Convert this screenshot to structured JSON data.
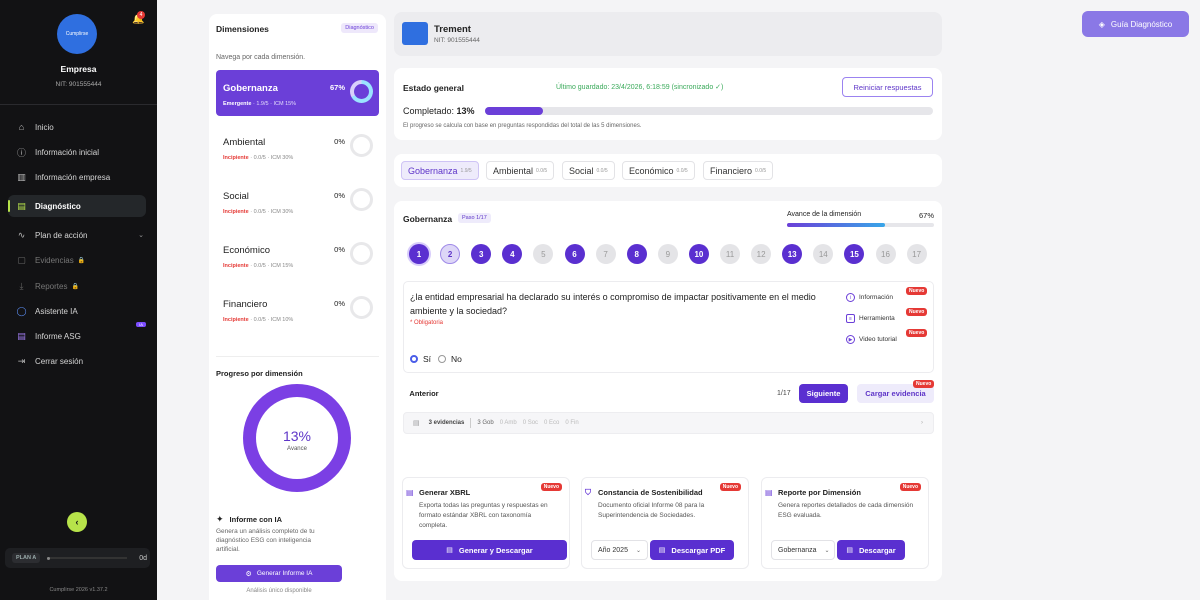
{
  "sidebar": {
    "company": "Empresa",
    "nit": "NIT: 901555444",
    "logo_text": "Cumplirse",
    "notifications": "4",
    "items": [
      {
        "label": "Inicio",
        "icon": "home-icon"
      },
      {
        "label": "Información inicial",
        "icon": "info-icon"
      },
      {
        "label": "Información empresa",
        "icon": "building-icon"
      },
      {
        "label": "Diagnóstico",
        "icon": "document-icon",
        "active": true
      },
      {
        "label": "Plan de acción",
        "icon": "activity-icon"
      },
      {
        "label": "Evidencias",
        "icon": "file-icon",
        "locked": true
      },
      {
        "label": "Reportes",
        "icon": "download-icon",
        "locked": true
      },
      {
        "label": "Asistente IA",
        "icon": "circle-icon"
      },
      {
        "label": "Informe ASG",
        "icon": "report-icon",
        "badge": "IA"
      },
      {
        "label": "Cerrar sesión",
        "icon": "logout-icon"
      }
    ],
    "plan_label": "PLAN A",
    "plan_days": "0d",
    "version": "Cumplirse 2026 v1.37.2"
  },
  "dimensions": {
    "title": "Dimensiones",
    "tag": "Diagnóstico",
    "subtitle": "Navega por cada dimensión.",
    "items": [
      {
        "name": "Gobernanza",
        "pct": "67%",
        "level": "Emergente",
        "score": "1.9/5",
        "icm": "ICM 15%",
        "progress": 0.67
      },
      {
        "name": "Ambiental",
        "pct": "0%",
        "level": "Incipiente",
        "score": "0.0/5",
        "icm": "ICM 30%",
        "progress": 0
      },
      {
        "name": "Social",
        "pct": "0%",
        "level": "Incipiente",
        "score": "0.0/5",
        "icm": "ICM 30%",
        "progress": 0
      },
      {
        "name": "Económico",
        "pct": "0%",
        "level": "Incipiente",
        "score": "0.0/5",
        "icm": "ICM 15%",
        "progress": 0
      },
      {
        "name": "Financiero",
        "pct": "0%",
        "level": "Incipiente",
        "score": "0.0/5",
        "icm": "ICM 10%",
        "progress": 0
      }
    ],
    "progress_title": "Progreso por dimensión",
    "progress_value": "13%",
    "progress_label": "Avance",
    "ai_title": "Informe con IA",
    "ai_desc": "Genera un análisis completo de tu diagnóstico ESG con inteligencia artificial.",
    "ai_button": "Generar Informe IA",
    "ai_note": "Análisis único disponible"
  },
  "header": {
    "name": "Trement",
    "nit": "NIT: 901555444",
    "guide_button": "Guía Diagnóstico"
  },
  "status": {
    "title": "Estado general",
    "saved": "Último guardado: 23/4/2026, 6:18:59 (sincronizado ✓)",
    "reset_button": "Reiniciar respuestas",
    "completed_label": "Completado:",
    "completed_value": "13%",
    "completed_fraction": 0.13,
    "note": "El progreso se calcula con base en preguntas respondidas del total de las 5 dimensiones."
  },
  "tabs": [
    {
      "label": "Gobernanza",
      "score": "1.9/5"
    },
    {
      "label": "Ambiental",
      "score": "0.0/5"
    },
    {
      "label": "Social",
      "score": "0.0/5"
    },
    {
      "label": "Económico",
      "score": "0.0/5"
    },
    {
      "label": "Financiero",
      "score": "0.0/5"
    }
  ],
  "question": {
    "section": "Gobernanza",
    "step_tag": "Paso 1/17",
    "advance_label": "Avance de la dimensión",
    "advance_pct": "67%",
    "advance_fraction": 0.67,
    "steps": [
      "1",
      "2",
      "3",
      "4",
      "5",
      "6",
      "7",
      "8",
      "9",
      "10",
      "11",
      "12",
      "13",
      "14",
      "15",
      "16",
      "17"
    ],
    "text": "¿la entidad empresarial ha declarado su interés o compromiso de impactar positivamente en el medio ambiente y la sociedad?",
    "required": "* Obligatoria",
    "links": [
      {
        "label": "Información",
        "badge": "Nuevo"
      },
      {
        "label": "Herramienta",
        "badge": "Nuevo"
      },
      {
        "label": "Video tutorial",
        "badge": "Nuevo"
      }
    ],
    "option_yes": "Sí",
    "option_no": "No",
    "prev": "Anterior",
    "page": "1/17",
    "next": "Siguiente",
    "upload": "Cargar evidencia",
    "upload_badge": "Nuevo",
    "evidence_count": "3 evidencias",
    "ev_gob": "3 Gob",
    "ev_amb": "0 Amb",
    "ev_soc": "0 Soc",
    "ev_eco": "0 Eco",
    "ev_fin": "0 Fin"
  },
  "exports": [
    {
      "title": "Generar XBRL",
      "badge": "Nuevo",
      "desc": "Exporta todas las preguntas y respuestas en formato estándar XBRL con taxonomía completa.",
      "button": "Generar y Descargar"
    },
    {
      "title": "Constancia de Sostenibilidad",
      "badge": "Nuevo",
      "desc": "Documento oficial Informe 08 para la Superintendencia de Sociedades.",
      "select": "Año 2025",
      "button": "Descargar PDF"
    },
    {
      "title": "Reporte por Dimensión",
      "badge": "Nuevo",
      "desc": "Genera reportes detallados de cada dimensión ESG evaluada.",
      "select": "Gobernanza",
      "button": "Descargar"
    }
  ]
}
